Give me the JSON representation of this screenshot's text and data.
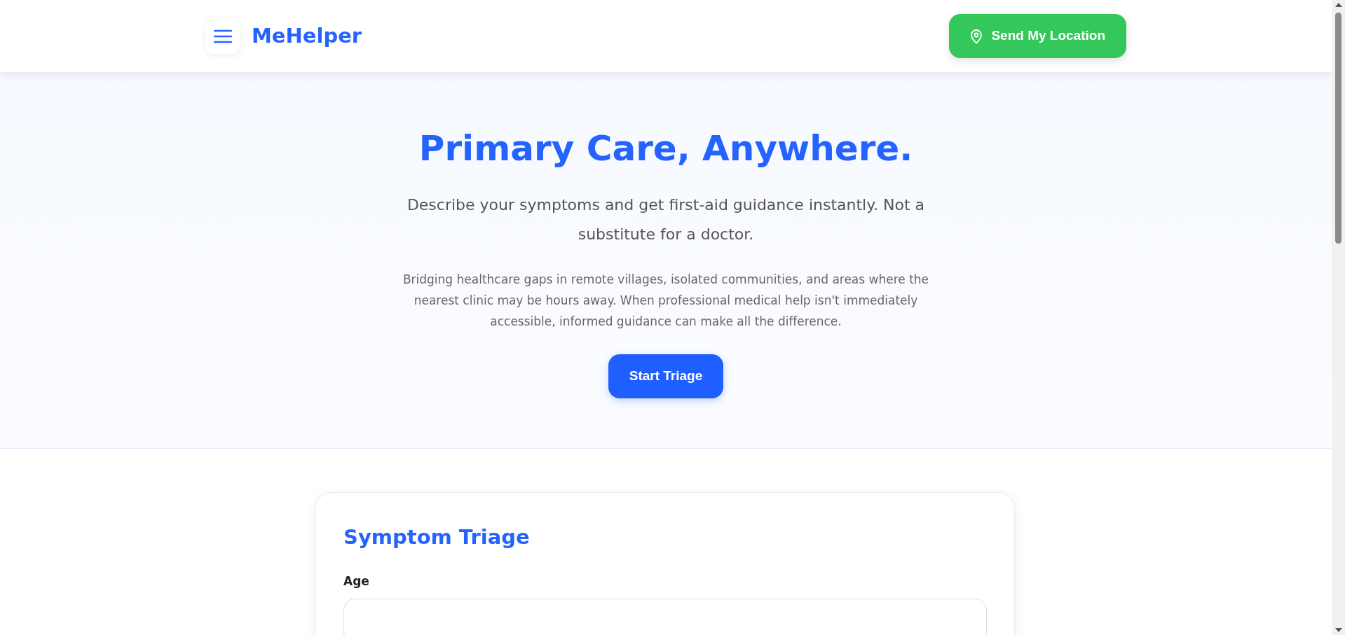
{
  "header": {
    "logo": "MeHelper",
    "location_button": "Send My Location"
  },
  "hero": {
    "title": "Primary Care, Anywhere.",
    "subtitle": "Describe your symptoms and get first-aid guidance instantly. Not a substitute for a doctor.",
    "description": "Bridging healthcare gaps in remote villages, isolated communities, and areas where the nearest clinic may be hours away. When professional medical help isn't immediately accessible, informed guidance can make all the difference.",
    "button": "Start Triage"
  },
  "triage": {
    "title": "Symptom Triage",
    "fields": [
      {
        "label": "Age"
      }
    ]
  }
}
